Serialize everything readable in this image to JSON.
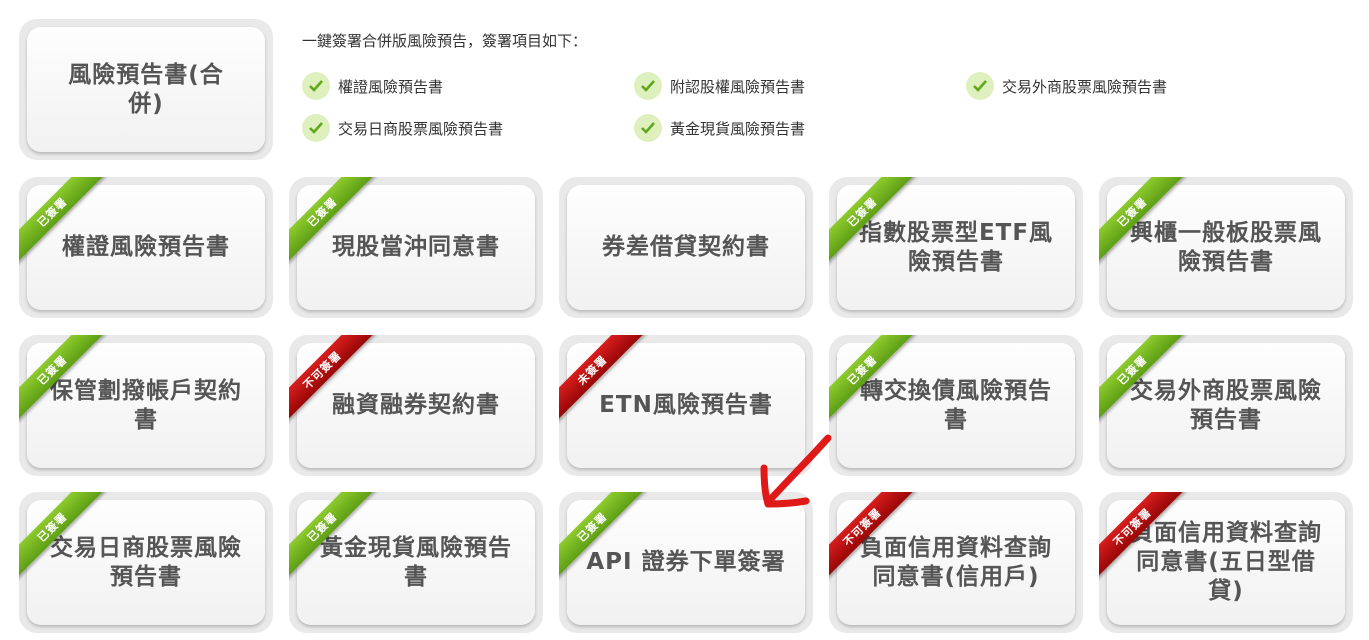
{
  "merged": {
    "label": "風險預告書(合併)",
    "intro": "一鍵簽署合併版風險預告，簽署項目如下：",
    "items": [
      "權證風險預告書",
      "附認股權風險預告書",
      "交易外商股票風險預告書",
      "交易日商股票風險預告書",
      "黃金現貨風險預告書"
    ]
  },
  "cards": [
    {
      "label": "權證風險預告書",
      "status": "已簽署",
      "status_color": "#6fb21e"
    },
    {
      "label": "現股當沖同意書",
      "status": "已簽署",
      "status_color": "#6fb21e"
    },
    {
      "label": "券差借貸契約書",
      "status": "",
      "status_color": ""
    },
    {
      "label": "指數股票型ETF風險預告書",
      "status": "已簽署",
      "status_color": "#6fb21e"
    },
    {
      "label": "興櫃一般板股票風險預告書",
      "status": "已簽署",
      "status_color": "#6fb21e"
    },
    {
      "label": "保管劃撥帳戶契約書",
      "status": "已簽署",
      "status_color": "#6fb21e"
    },
    {
      "label": "融資融券契約書",
      "status": "不可簽署",
      "status_color": "#c01010"
    },
    {
      "label": "ETN風險預告書",
      "status": "未簽署",
      "status_color": "#c01010"
    },
    {
      "label": "轉交換債風險預告書",
      "status": "已簽署",
      "status_color": "#6fb21e"
    },
    {
      "label": "交易外商股票風險預告書",
      "status": "已簽署",
      "status_color": "#6fb21e"
    },
    {
      "label": "交易日商股票風險預告書",
      "status": "已簽署",
      "status_color": "#6fb21e"
    },
    {
      "label": "黃金現貨風險預告書",
      "status": "已簽署",
      "status_color": "#6fb21e"
    },
    {
      "label": "API 證券下單簽署",
      "status": "已簽署",
      "status_color": "#6fb21e"
    },
    {
      "label": "負面信用資料查詢同意書(信用戶)",
      "status": "不可簽署",
      "status_color": "#c01010"
    },
    {
      "label": "負面信用資料查詢同意書(五日型借貸)",
      "status": "不可簽署",
      "status_color": "#c01010"
    }
  ],
  "annotation": {
    "icon": "red-arrow-icon",
    "color": "#e01818"
  }
}
